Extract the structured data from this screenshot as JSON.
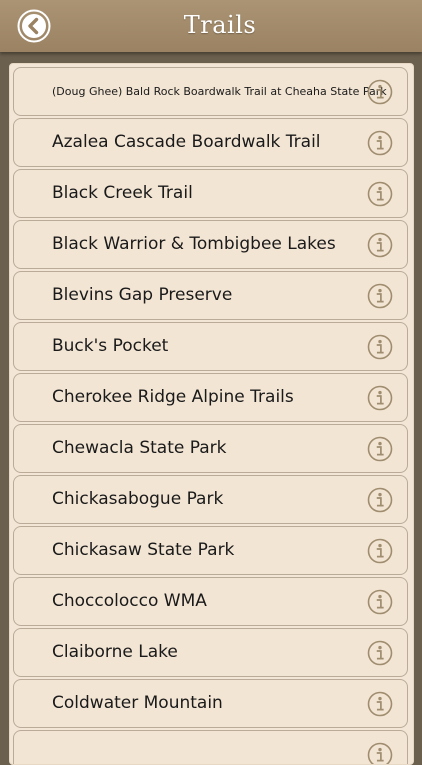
{
  "header": {
    "title": "Trails"
  },
  "trails": [
    "(Doug Ghee) Bald Rock Boardwalk Trail at Cheaha State Park",
    "Azalea Cascade Boardwalk Trail",
    "Black Creek Trail",
    "Black Warrior & Tombigbee Lakes",
    "Blevins Gap Preserve",
    "Buck's Pocket",
    "Cherokee Ridge Alpine Trails",
    "Chewacla State Park",
    "Chickasabogue Park",
    "Chickasaw State Park",
    "Choccolocco WMA",
    "Claiborne Lake",
    "Coldwater Mountain",
    ""
  ],
  "icons": {
    "back": "back-arrow-circle-icon",
    "info": "info-icon"
  },
  "colors": {
    "header": "#a48c6b",
    "background": "#6b5f4d",
    "row": "#f3e5d4",
    "row_border": "#b9ab98",
    "info_icon": "#a08d70"
  }
}
